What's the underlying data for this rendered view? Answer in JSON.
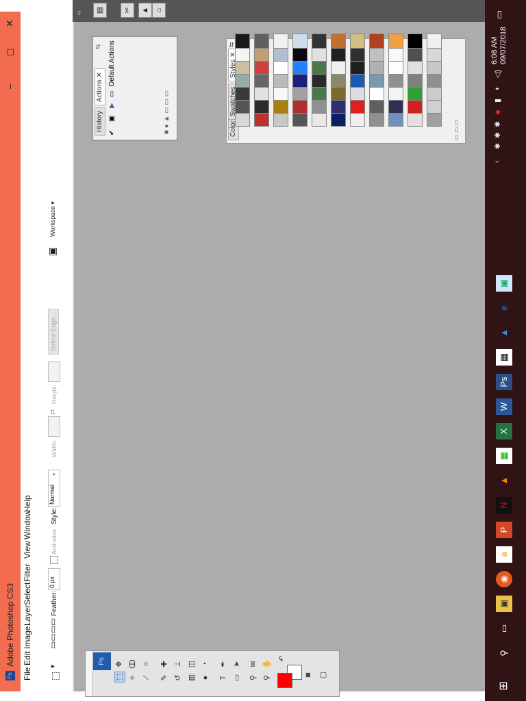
{
  "window": {
    "title": "Adobe Photoshop CS3",
    "app_badge": "Ps",
    "controls": {
      "minimize": "–",
      "restore": "◻",
      "close": "✕"
    }
  },
  "menu": [
    "File",
    "Edit",
    "Image",
    "Layer",
    "Select",
    "Filter",
    "View",
    "Window",
    "Help"
  ],
  "options": {
    "feather_label": "Feather:",
    "feather_value": "0 px",
    "antialias_label": "Anti-alias",
    "style_label": "Style:",
    "style_value": "Normal",
    "width_label": "Width:",
    "height_label": "Height:",
    "refine_edge": "Refine Edge...",
    "workspace": "Workspace ▾"
  },
  "toolbox": {
    "logo": "Ps"
  },
  "actions_panel": {
    "tabs": [
      "History",
      "Actions ✕"
    ],
    "item": "Default Actions"
  },
  "styles_panel": {
    "tabs": [
      "Color",
      "Swatches",
      "Styles ✕"
    ]
  },
  "taskbar": {
    "time": "6:08 AM",
    "date": "09/07/2018"
  },
  "colors": {
    "titlebar": "#f26d50",
    "workspace": "#acacac",
    "taskbar": "#301314",
    "foreground": "#ff0000",
    "background": "#ffffff"
  },
  "swatches": [
    [
      "#d8d8d8",
      "#555",
      "#3a3a3a",
      "#9aa",
      "#c8c0a0",
      "#f4f4f4",
      "#1a1a1a"
    ],
    [
      "#c03030",
      "#2a2a2a",
      "#e0e0e0",
      "#666",
      "#d04040",
      "#c0a070",
      "#606060"
    ],
    [
      "#c8c8c8",
      "#a88010",
      "#f8f8f8",
      "#bbbbbb",
      "#ffffff",
      "#b0c0d0",
      "#f0f0f0"
    ],
    [
      "#555555",
      "#b03030",
      "#a0a0a0",
      "#1a2080",
      "#2080ff",
      "#0a0a0a",
      "#cde"
    ],
    [
      "#e8e8e8",
      "#909090",
      "#4a7a4a",
      "#2a2a2a",
      "#4a7a4a",
      "#e0e0e0",
      "#333"
    ],
    [
      "#0a2060",
      "#303070",
      "#7a6a30",
      "#8a8a6a",
      "#f0f0f0",
      "#202020",
      "#c07030"
    ],
    [
      "#f0f0f0",
      "#e02020",
      "#dddddd",
      "#1a5ab0",
      "#202020",
      "#303030",
      "#d0c080"
    ],
    [
      "#909090",
      "#606060",
      "#ffffff",
      "#7a9ab0",
      "#b0b0b0",
      "#c0c0c0",
      "#b04020"
    ],
    [
      "#7090c0",
      "#303050",
      "#f4f4f4",
      "#909090",
      "#ffffff",
      "#f8f8f8",
      "#f0a040"
    ],
    [
      "#e0e0e0",
      "#d02020",
      "#30a030",
      "#808080",
      "#e0e0e0",
      "#505050",
      "#000000"
    ],
    [
      "#a0a0a0",
      "#d0d0d0",
      "#cccccc",
      "#909090",
      "#c8c8c8",
      "#d8d8d8",
      "#f0f0f0"
    ]
  ]
}
